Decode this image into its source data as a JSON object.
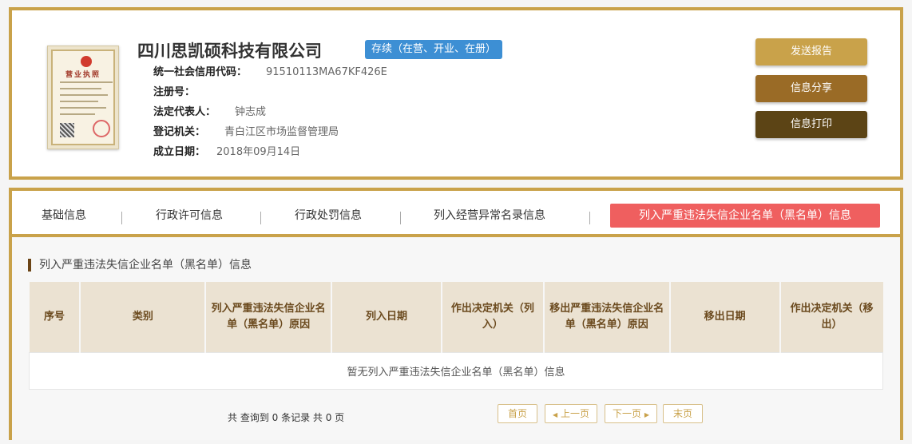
{
  "company": {
    "name": "四川思凯硕科技有限公司",
    "status": "存续（在营、开业、在册）",
    "license_title": "营业执照",
    "fields": [
      {
        "label": "统一社会信用代码：",
        "value": "91510113MA67KF426E"
      },
      {
        "label": "注册号：",
        "value": ""
      },
      {
        "label": "法定代表人：",
        "value": "钟志成"
      },
      {
        "label": "登记机关：",
        "value": "青白江区市场监督管理局"
      },
      {
        "label": "成立日期：",
        "value": "2018年09月14日"
      }
    ]
  },
  "actions": {
    "send_report": "发送报告",
    "share": "信息分享",
    "print": "信息打印"
  },
  "tabs": [
    {
      "label": "基础信息"
    },
    {
      "label": "行政许可信息"
    },
    {
      "label": "行政处罚信息"
    },
    {
      "label": "列入经营异常名录信息"
    },
    {
      "label": "列入严重违法失信企业名单（黑名单）信息",
      "active": true
    }
  ],
  "section": {
    "title": "列入严重违法失信企业名单（黑名单）信息",
    "columns": [
      "序号",
      "类别",
      "列入严重违法失信企业名单（黑名单）原因",
      "列入日期",
      "作出决定机关（列入）",
      "移出严重违法失信企业名单（黑名单）原因",
      "移出日期",
      "作出决定机关（移出）"
    ],
    "empty_text": "暂无列入严重违法失信企业名单（黑名单）信息"
  },
  "pagination": {
    "summary": "共 查询到 0 条记录 共 0 页",
    "first": "首页",
    "prev": "上一页",
    "next": "下一页",
    "last": "末页"
  },
  "colors": {
    "gold": "#c9a24a",
    "brown": "#9a6b26",
    "dark_brown": "#5c4415",
    "active_tab": "#ef5f5f",
    "status_blue": "#3d8fd4"
  }
}
